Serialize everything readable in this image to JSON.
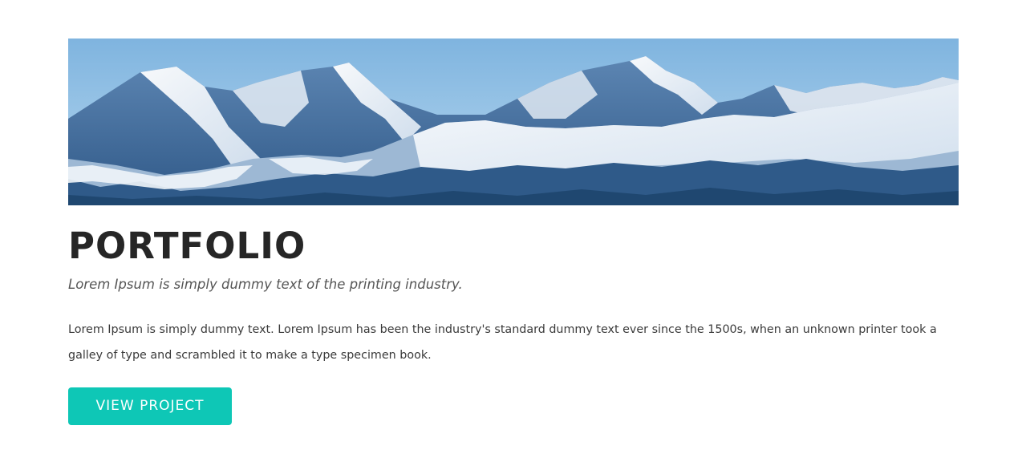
{
  "hero": {
    "image_name": "snowy-mountain-range-banner",
    "sky_color": "#8fc3e6",
    "snow_color": "#f4f7fb",
    "rock_color": "#3f6a99"
  },
  "portfolio": {
    "title": "PORTFOLIO",
    "subtitle": "Lorem Ipsum is simply dummy text of the printing industry.",
    "description": "Lorem Ipsum is simply dummy text. Lorem Ipsum has been the industry's standard dummy text ever since the 1500s, when an unknown printer took a galley of type and scrambled it to make a type specimen book.",
    "button_label": "VIEW PROJECT",
    "accent_color": "#0ec7b6"
  }
}
